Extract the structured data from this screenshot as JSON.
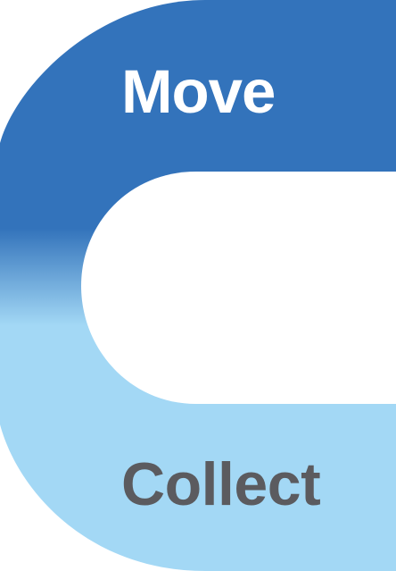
{
  "diagram": {
    "top_label": "Move",
    "bottom_label": "Collect"
  },
  "colors": {
    "top_band": "#3373BB",
    "bottom_band": "#A3D8F5",
    "top_label_text": "#FFFFFF",
    "bottom_label_text": "#5B5B5F",
    "background": "#FFFFFF"
  }
}
